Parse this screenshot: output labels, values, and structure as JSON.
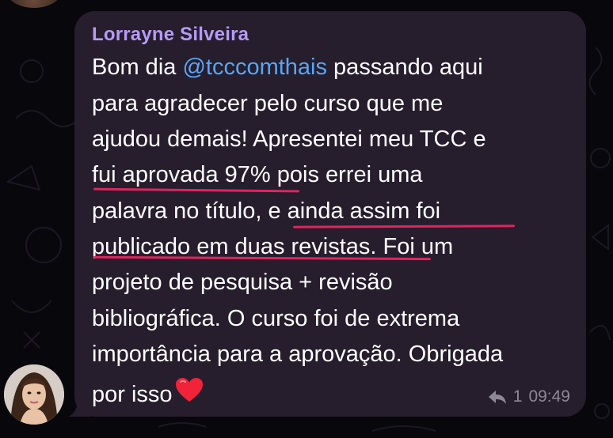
{
  "message": {
    "sender": "Lorrayne Silveira",
    "lines": [
      {
        "before": "Bom dia ",
        "mention": "@tcccomthais",
        "after": " passando aqui"
      },
      {
        "text": "para agradecer pelo curso que me"
      },
      {
        "text": "ajudou demais! Apresentei meu TCC e"
      },
      {
        "text": "fui aprovada 97% pois errei uma"
      },
      {
        "text": "palavra no título, e ainda assim foi"
      },
      {
        "text": "publicado em duas revistas. Foi um"
      },
      {
        "text": "projeto de pesquisa + revisão"
      },
      {
        "text": "bibliográfica. O curso foi de extrema"
      },
      {
        "text": "importância para a aprovação. Obrigada"
      },
      {
        "text": "por isso"
      }
    ],
    "emoji_icon": "red-heart-icon",
    "reply_count": "1",
    "time": "09:49"
  },
  "icons": {
    "reply": "reply-arrow-icon",
    "heart": "red-heart-icon"
  },
  "colors": {
    "bubble": "#261d2d",
    "sender": "#b79af7",
    "mention": "#5aa6f2",
    "highlight_underline": "#e0245e",
    "meta": "#8e8896"
  }
}
